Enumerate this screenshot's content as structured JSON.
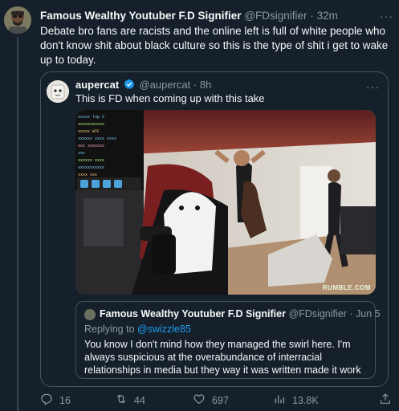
{
  "tweet": {
    "author_name": "Famous Wealthy Youtuber F.D Signifier",
    "author_handle": "@FDsignifier",
    "separator": "·",
    "time": "32m",
    "text": "Debate bro fans are racists and the online left is full of white people who don't know shit about black culture so this is the type of shit i get to wake up to today."
  },
  "quoted_tweet": {
    "author_name": "aupercat",
    "author_handle": "@aupercat",
    "separator": "·",
    "time": "8h",
    "text": "This is FD when coming up with this take",
    "media_watermark": "RUMBLE.COM"
  },
  "inner_quote": {
    "author_name": "Famous Wealthy Youtuber F.D Signifier",
    "author_handle": "@FDsignifier",
    "separator": "·",
    "time": "Jun 5",
    "reply_prefix": "Replying to ",
    "reply_to": "@swizzle85",
    "text": "You know I don't mind how they managed the swirl here. I'm always suspicious at the overabundance of interracial relationships in media but they way it was written made it work"
  },
  "actions": {
    "replies": "16",
    "retweets": "44",
    "likes": "697",
    "views": "13.8K"
  },
  "colors": {
    "background": "#15202b",
    "accent": "#1d9bf0",
    "muted": "#8b98a5",
    "border": "#425364"
  },
  "icons": [
    "reply-icon",
    "retweet-icon",
    "like-icon",
    "views-icon",
    "share-icon",
    "more-icon",
    "verified-badge-icon"
  ]
}
